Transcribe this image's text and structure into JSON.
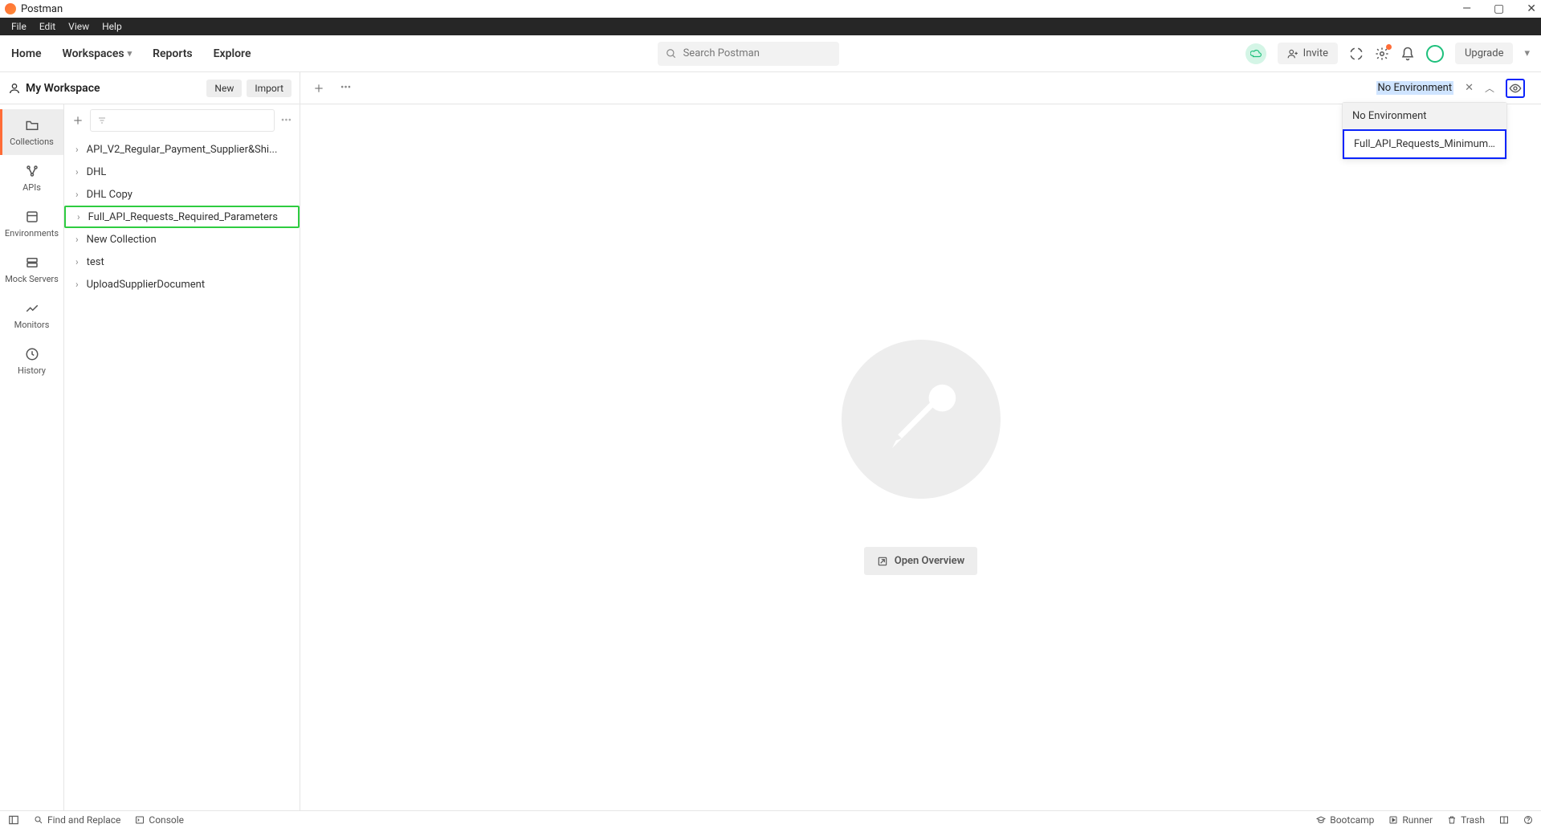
{
  "window": {
    "title": "Postman"
  },
  "menubar": [
    "File",
    "Edit",
    "View",
    "Help"
  ],
  "topnav": {
    "home": "Home",
    "workspaces": "Workspaces",
    "reports": "Reports",
    "explore": "Explore",
    "search_placeholder": "Search Postman",
    "invite": "Invite",
    "upgrade": "Upgrade"
  },
  "workspace": {
    "name": "My Workspace",
    "new_label": "New",
    "import_label": "Import"
  },
  "sidebar_rail": [
    {
      "label": "Collections"
    },
    {
      "label": "APIs"
    },
    {
      "label": "Environments"
    },
    {
      "label": "Mock Servers"
    },
    {
      "label": "Monitors"
    },
    {
      "label": "History"
    }
  ],
  "collections": [
    {
      "label": "API_V2_Regular_Payment_Supplier&Shi...",
      "highlight": false
    },
    {
      "label": "DHL",
      "highlight": false
    },
    {
      "label": "DHL Copy",
      "highlight": false
    },
    {
      "label": "Full_API_Requests_Required_Parameters",
      "highlight": true
    },
    {
      "label": "New Collection",
      "highlight": false
    },
    {
      "label": "test",
      "highlight": false
    },
    {
      "label": "UploadSupplierDocument",
      "highlight": false
    }
  ],
  "env_selector": {
    "current": "No Environment",
    "options": [
      {
        "label": "No Environment",
        "active": true,
        "highlight": false
      },
      {
        "label": "Full_API_Requests_Minimum_...",
        "active": false,
        "highlight": true
      }
    ]
  },
  "content": {
    "open_overview": "Open Overview"
  },
  "statusbar": {
    "find_replace": "Find and Replace",
    "console": "Console",
    "bootcamp": "Bootcamp",
    "runner": "Runner",
    "trash": "Trash"
  }
}
